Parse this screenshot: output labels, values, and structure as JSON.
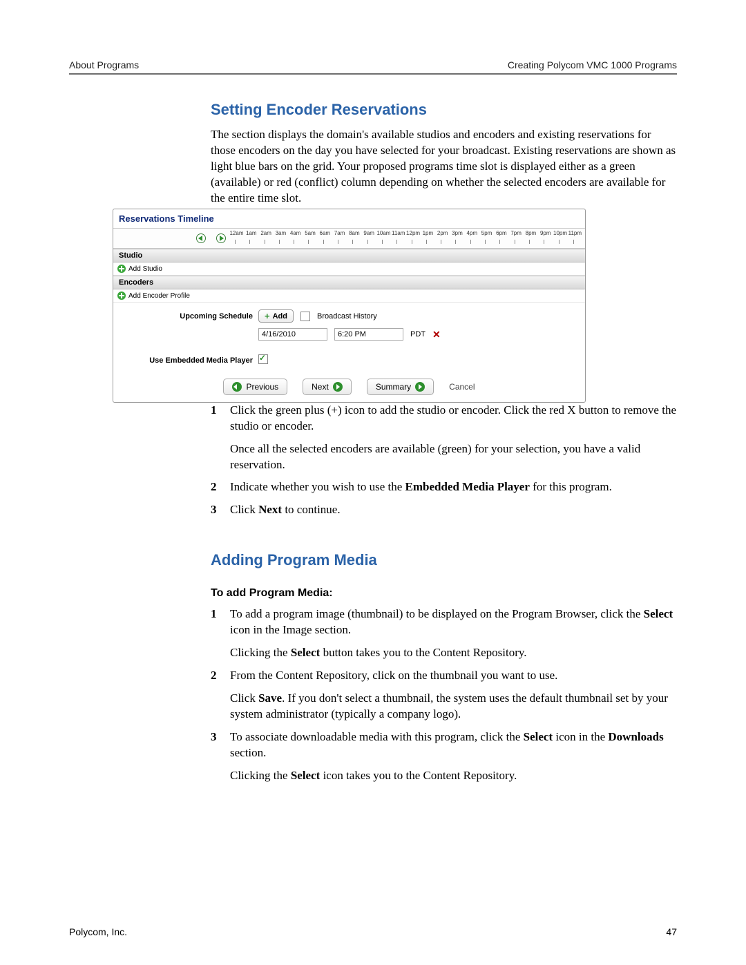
{
  "header": {
    "left": "About Programs",
    "right": "Creating Polycom VMC 1000 Programs"
  },
  "heading1": "Setting Encoder Reservations",
  "intro1": "The section displays the domain's available studios and encoders and existing reservations for those encoders on the day you have selected for your broadcast. Existing reservations are shown as light blue bars on the grid. Your proposed programs time slot is displayed either as a green (available) or red (conflict) column depending on whether the selected encoders are available for the entire time slot.",
  "panel": {
    "title": "Reservations Timeline",
    "hours": [
      "12am",
      "1am",
      "2am",
      "3am",
      "4am",
      "5am",
      "6am",
      "7am",
      "8am",
      "9am",
      "10am",
      "11am",
      "12pm",
      "1pm",
      "2pm",
      "3pm",
      "4pm",
      "5pm",
      "6pm",
      "7pm",
      "8pm",
      "9pm",
      "10pm",
      "11pm"
    ],
    "sections": {
      "studio_label": "Studio",
      "add_studio": "Add Studio",
      "encoders_label": "Encoders",
      "add_encoder": "Add Encoder Profile"
    },
    "form": {
      "upcoming_label": "Upcoming Schedule",
      "add_btn": "Add",
      "history_label": "Broadcast History",
      "date": "4/16/2010",
      "time": "6:20 PM",
      "tz": "PDT",
      "use_embedded_label": "Use Embedded Media Player"
    },
    "nav": {
      "previous": "Previous",
      "next": "Next",
      "summary": "Summary",
      "cancel": "Cancel"
    }
  },
  "steps1": {
    "s1a": "Click the green plus (+) icon to add the studio or encoder. Click the red X button to remove the studio or encoder.",
    "s1b": "Once all the selected encoders are available (green) for your selection, you have a valid reservation.",
    "s2a": "Indicate whether you wish to use the ",
    "s2b": "Embedded Media Player",
    "s2c": " for this program.",
    "s3a": "Click ",
    "s3b": "Next",
    "s3c": " to continue."
  },
  "heading2": "Adding Program Media",
  "subhead2": "To add Program Media:",
  "steps2": {
    "s1a": "To add a program image (thumbnail) to be displayed on the Program Browser, click the ",
    "s1b": "Select",
    "s1c": " icon in the Image section.",
    "s1d1": "Clicking the ",
    "s1d2": "Select",
    "s1d3": " button takes you to the Content Repository.",
    "s2a": "From the Content Repository, click on the thumbnail you want to use.",
    "s2b1": "Click ",
    "s2b2": "Save",
    "s2b3": ". If you don't select a thumbnail, the system uses the default thumbnail set by your system administrator (typically a company logo).",
    "s3a": "To associate downloadable media with this program, click the ",
    "s3b": "Select",
    "s3c": " icon in the ",
    "s3d": "Downloads",
    "s3e": " section.",
    "s3f1": "Clicking the ",
    "s3f2": "Select",
    "s3f3": " icon takes you to the Content Repository."
  },
  "footer": {
    "left": "Polycom, Inc.",
    "right": "47"
  }
}
